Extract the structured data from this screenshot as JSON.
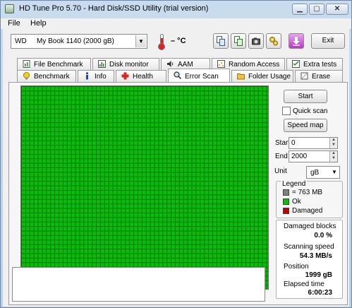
{
  "window": {
    "title": "HD Tune Pro 5.70 - Hard Disk/SSD Utility (trial version)"
  },
  "menu": {
    "items": [
      "File",
      "Help"
    ]
  },
  "toolbar": {
    "drive_id": "WD",
    "drive_name": "My Book 1140 (2000 gB)",
    "temperature": "– °C",
    "exit_label": "Exit"
  },
  "tabs": {
    "row1": [
      "File Benchmark",
      "Disk monitor",
      "AAM",
      "Random Access",
      "Extra tests"
    ],
    "row2": [
      "Benchmark",
      "Info",
      "Health",
      "Error Scan",
      "Folder Usage",
      "Erase"
    ],
    "active": "Error Scan"
  },
  "scan": {
    "start_button": "Start",
    "quick_scan_label": "Quick scan",
    "quick_scan_checked": false,
    "speed_map_button": "Speed map",
    "start_label": "Start",
    "start_value": "0",
    "end_label": "End",
    "end_value": "2000",
    "unit_label": "Unit",
    "unit_value": "gB"
  },
  "legend": {
    "title": "Legend",
    "block_size": "= 763 MB",
    "ok": "Ok",
    "damaged": "Damaged"
  },
  "stats": {
    "damaged_blocks_label": "Damaged blocks",
    "damaged_blocks_value": "0.0 %",
    "scanning_speed_label": "Scanning speed",
    "scanning_speed_value": "54.3 MB/s",
    "position_label": "Position",
    "position_value": "1999 gB",
    "elapsed_label": "Elapsed time",
    "elapsed_value": "6:00:23"
  },
  "colors": {
    "block_ok": "#00c200",
    "block_damaged": "#c00000",
    "block_unused": "#808080"
  }
}
